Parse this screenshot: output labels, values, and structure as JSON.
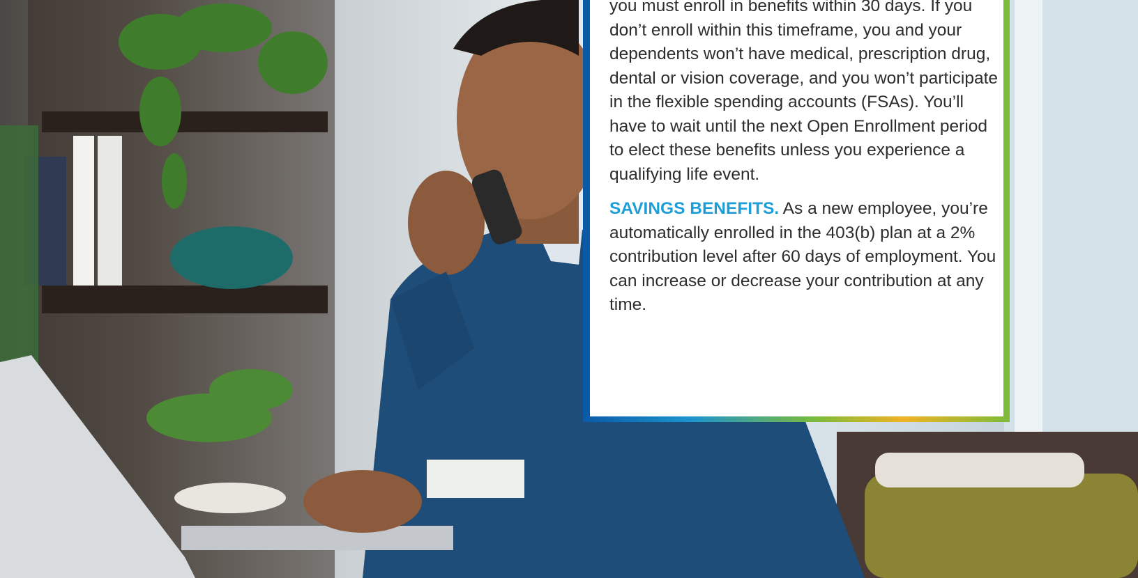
{
  "card": {
    "paragraph1": "you must enroll in benefits within 30 days. If you don’t enroll within this timeframe, you and your dependents won’t have medical, prescription drug, dental or vision coverage, and you won’t participate in the flexible spending accounts (FSAs). You’ll have to wait until the next Open Enrollment period to elect these benefits unless you experience a qualifying life event.",
    "savings_lead": "SAVINGS BENEFITS.",
    "savings_text": " As a new employee, you’re automatically enrolled in the 403(b) plan at a 2% contribution level after 60 days of employment. You can increase or decrease your contribution at any time."
  },
  "colors": {
    "accent_blue": "#1e9ed8",
    "border_navy": "#0b5aa8",
    "border_green": "#7dbb3a",
    "sweater": "#1d4d78"
  }
}
